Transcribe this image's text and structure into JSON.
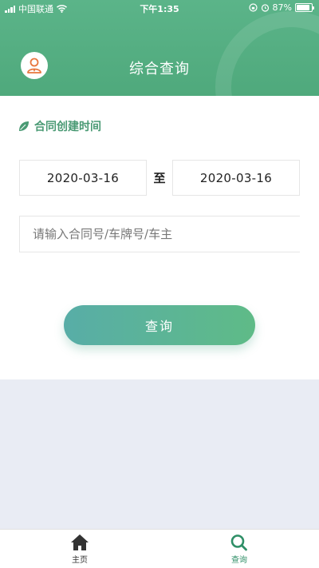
{
  "status_bar": {
    "carrier": "中国联通",
    "time": "下午1:35",
    "battery": "87%",
    "battery_level": 0.87
  },
  "header": {
    "title": "综合查询",
    "avatar_icon": "user-avatar-icon",
    "accent_color": "#55ae84"
  },
  "form": {
    "section_label": "合同创建时间",
    "section_icon": "leaf-icon",
    "start_date": "2020-03-16",
    "separator": "至",
    "end_date": "2020-03-16",
    "search_placeholder": "请输入合同号/车牌号/车主",
    "search_value": "",
    "query_button": "查询"
  },
  "tabbar": {
    "items": [
      {
        "label": "主页",
        "icon": "home-icon",
        "active": false
      },
      {
        "label": "查询",
        "icon": "search-icon",
        "active": true
      }
    ]
  }
}
